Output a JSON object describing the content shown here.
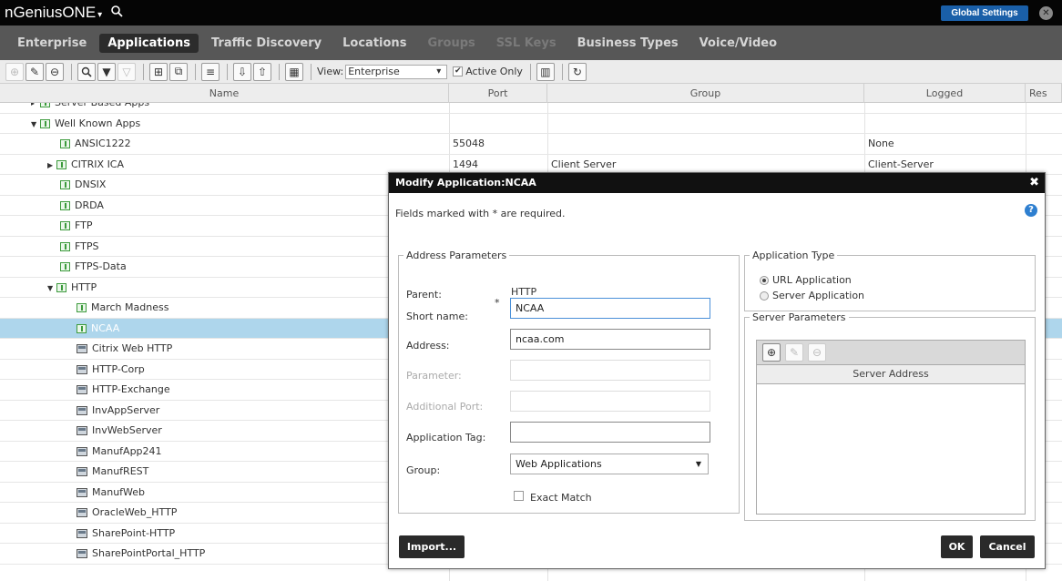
{
  "app": {
    "brand_main": "nGenius",
    "brand_one": "ONE",
    "brand_caret": "▾",
    "search_icon": "search-icon",
    "global_settings": "Global Settings",
    "close_glyph": "✕"
  },
  "nav": {
    "tabs": [
      "Enterprise",
      "Applications",
      "Traffic Discovery",
      "Locations",
      "Groups",
      "SSL Keys",
      "Business Types",
      "Voice/Video"
    ],
    "active": "Applications",
    "disabled": [
      "Groups",
      "SSL Keys"
    ]
  },
  "toolbar": {
    "view_label": "View:",
    "view_value": "Enterprise",
    "active_only_label": "Active Only",
    "active_only_checked": true
  },
  "grid": {
    "columns": {
      "name": "Name",
      "port": "Port",
      "group": "Group",
      "logged": "Logged",
      "res": "Res"
    },
    "rows": [
      {
        "name": "Server Based Apps",
        "indent": 1,
        "twist": "▸",
        "icon": "app",
        "port": "",
        "group": "",
        "logged": ""
      },
      {
        "name": "Well Known Apps",
        "indent": 1,
        "twist": "▼",
        "icon": "app",
        "port": "",
        "group": "",
        "logged": ""
      },
      {
        "name": "ANSIC1222",
        "indent": 2,
        "twist": "",
        "icon": "app",
        "port": "55048",
        "group": "",
        "logged": "None"
      },
      {
        "name": "CITRIX ICA",
        "indent": 2,
        "twist": "▶",
        "icon": "app",
        "port": "1494",
        "group": "Client Server",
        "logged": "Client-Server"
      },
      {
        "name": "DNSIX",
        "indent": 2,
        "twist": "",
        "icon": "app",
        "port": "",
        "group": "",
        "logged": ""
      },
      {
        "name": "DRDA",
        "indent": 2,
        "twist": "",
        "icon": "app",
        "port": "",
        "group": "",
        "logged": ""
      },
      {
        "name": "FTP",
        "indent": 2,
        "twist": "",
        "icon": "app",
        "port": "",
        "group": "",
        "logged": ""
      },
      {
        "name": "FTPS",
        "indent": 2,
        "twist": "",
        "icon": "app",
        "port": "",
        "group": "",
        "logged": ""
      },
      {
        "name": "FTPS-Data",
        "indent": 2,
        "twist": "",
        "icon": "app",
        "port": "",
        "group": "",
        "logged": ""
      },
      {
        "name": "HTTP",
        "indent": 2,
        "twist": "▼",
        "icon": "app",
        "port": "",
        "group": "",
        "logged": ""
      },
      {
        "name": "March Madness",
        "indent": 3,
        "twist": "",
        "icon": "app",
        "port": "",
        "group": "",
        "logged": ""
      },
      {
        "name": "NCAA",
        "indent": 3,
        "twist": "",
        "icon": "app",
        "port": "",
        "group": "",
        "logged": "",
        "selected": true
      },
      {
        "name": "Citrix Web HTTP",
        "indent": 3,
        "twist": "",
        "icon": "srv",
        "port": "",
        "group": "",
        "logged": ""
      },
      {
        "name": "HTTP-Corp",
        "indent": 3,
        "twist": "",
        "icon": "srv",
        "port": "",
        "group": "",
        "logged": ""
      },
      {
        "name": "HTTP-Exchange",
        "indent": 3,
        "twist": "",
        "icon": "srv",
        "port": "",
        "group": "",
        "logged": ""
      },
      {
        "name": "InvAppServer",
        "indent": 3,
        "twist": "",
        "icon": "srv",
        "port": "",
        "group": "",
        "logged": ""
      },
      {
        "name": "InvWebServer",
        "indent": 3,
        "twist": "",
        "icon": "srv",
        "port": "",
        "group": "",
        "logged": ""
      },
      {
        "name": "ManufApp241",
        "indent": 3,
        "twist": "",
        "icon": "srv",
        "port": "",
        "group": "",
        "logged": ""
      },
      {
        "name": "ManufREST",
        "indent": 3,
        "twist": "",
        "icon": "srv",
        "port": "",
        "group": "",
        "logged": ""
      },
      {
        "name": "ManufWeb",
        "indent": 3,
        "twist": "",
        "icon": "srv",
        "port": "",
        "group": "",
        "logged": ""
      },
      {
        "name": "OracleWeb_HTTP",
        "indent": 3,
        "twist": "",
        "icon": "srv",
        "port": "",
        "group": "",
        "logged": ""
      },
      {
        "name": "SharePoint-HTTP",
        "indent": 3,
        "twist": "",
        "icon": "srv",
        "port": "",
        "group": "",
        "logged": ""
      },
      {
        "name": "SharePointPortal_HTTP",
        "indent": 3,
        "twist": "",
        "icon": "srv",
        "port": "",
        "group": "",
        "logged": ""
      }
    ]
  },
  "dialog": {
    "title": "Modify Application:NCAA",
    "close": "✖",
    "required_note": "Fields marked with * are required.",
    "help": "?",
    "address_legend": "Address Parameters",
    "parent_label": "Parent:",
    "parent_value": "HTTP",
    "short_name_label": "Short name:",
    "required_mark": "*",
    "short_name_value": "NCAA",
    "address_label": "Address:",
    "address_value": "ncaa.com",
    "parameter_label": "Parameter:",
    "parameter_value": "",
    "additional_port_label": "Additional Port:",
    "additional_port_value": "",
    "app_tag_label": "Application Tag:",
    "app_tag_value": "",
    "group_label": "Group:",
    "group_value": "Web Applications",
    "exact_match_label": "Exact Match",
    "exact_match_checked": false,
    "app_type_legend": "Application Type",
    "url_app_label": "URL Application",
    "server_app_label": "Server Application",
    "selected_type": "URL Application",
    "server_params_legend": "Server Parameters",
    "server_address_header": "Server Address",
    "import_label": "Import...",
    "ok_label": "OK",
    "cancel_label": "Cancel"
  }
}
